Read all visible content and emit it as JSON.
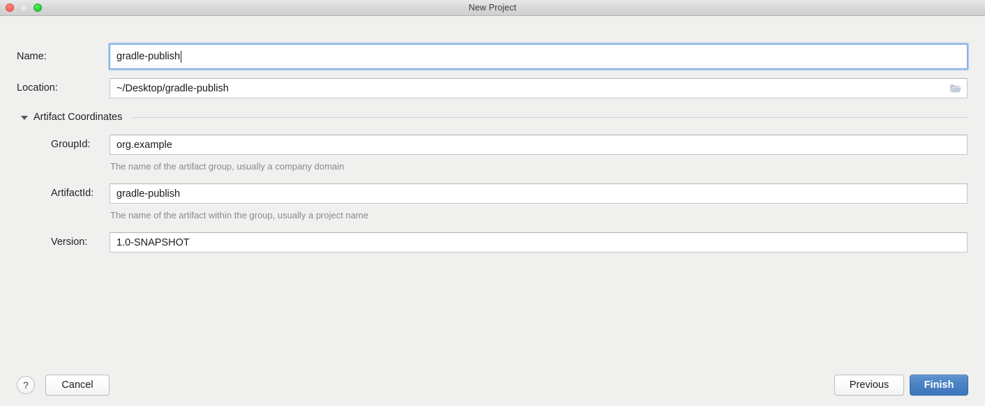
{
  "window": {
    "title": "New Project",
    "controls": {
      "close": "close-button",
      "minimize": "minimize-button",
      "zoom": "zoom-button"
    }
  },
  "form": {
    "name": {
      "label": "Name:",
      "value": "gradle-publish",
      "focused": true
    },
    "location": {
      "label": "Location:",
      "value": "~/Desktop/gradle-publish",
      "browse_icon": "folder-icon"
    }
  },
  "artifact_section": {
    "title": "Artifact Coordinates",
    "expanded": true,
    "disclosure_icon": "triangle-down-icon",
    "fields": [
      {
        "label": "GroupId:",
        "value": "org.example",
        "hint": "The name of the artifact group, usually a company domain"
      },
      {
        "label": "ArtifactId:",
        "value": "gradle-publish",
        "hint": "The name of the artifact within the group, usually a project name"
      },
      {
        "label": "Version:",
        "value": "1.0-SNAPSHOT",
        "hint": ""
      }
    ]
  },
  "footer": {
    "help_label": "?",
    "cancel_label": "Cancel",
    "previous_label": "Previous",
    "finish_label": "Finish"
  },
  "colors": {
    "window_background": "#f0f0ef",
    "titlebar_top": "#e8e8e8",
    "titlebar_bottom": "#cfcfcf",
    "field_background": "#ffffff",
    "field_border": "#c6c6c6",
    "focus_ring": "#a8c9ec",
    "focus_border": "#6f9fd8",
    "primary_button": "#4a82c4",
    "primary_button_border": "#2f6aaf",
    "hint_text": "#8a8a8a",
    "label_text": "#222222",
    "separator": "#d2d2d2",
    "close_dot": "#fb6a60",
    "minimize_dot": "#e6e6e6",
    "zoom_dot": "#2ed03c"
  }
}
